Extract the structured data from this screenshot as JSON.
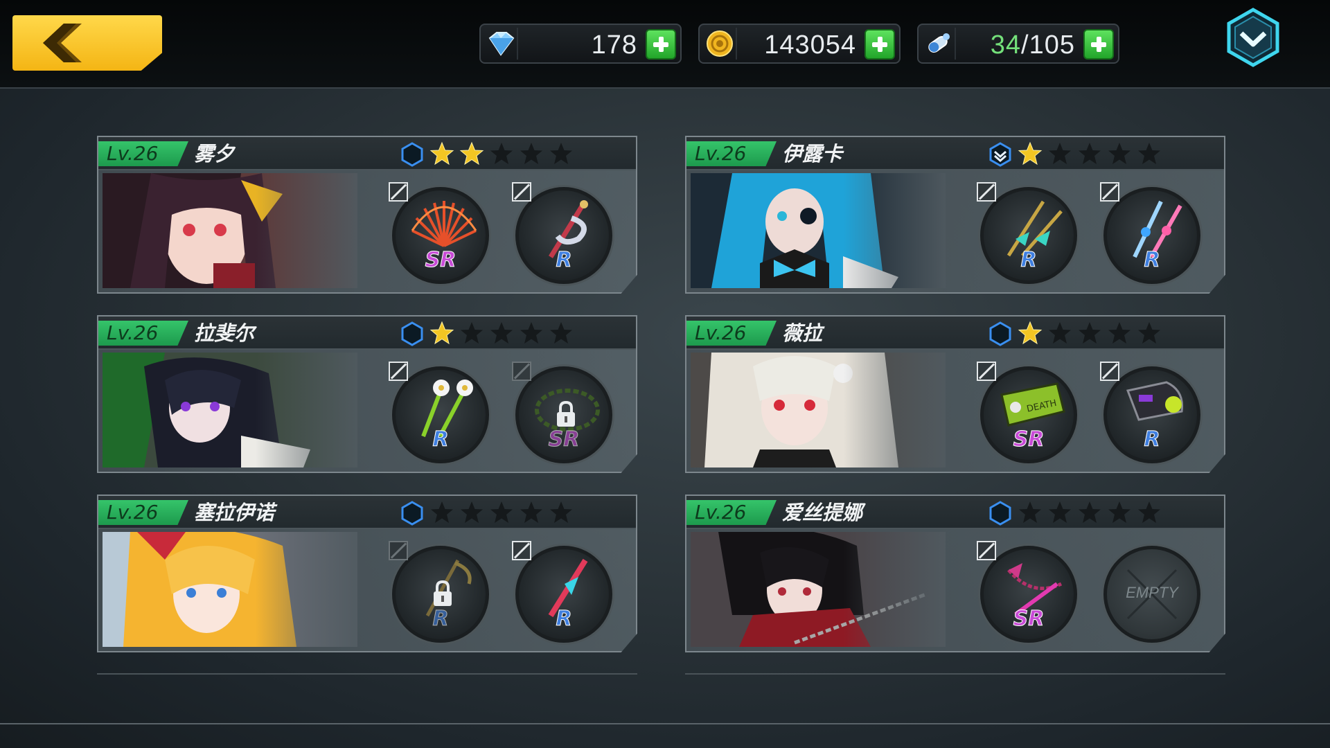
{
  "resources": {
    "gems": {
      "value": "178",
      "icon": "diamond-icon"
    },
    "gold": {
      "value": "143054",
      "icon": "coin-icon"
    },
    "energy": {
      "current": "34",
      "max": "/105",
      "icon": "potion-icon"
    }
  },
  "colors": {
    "level_badge": "#2bb35c",
    "back_button": "#f4b514",
    "plus_button": "#2fbf37",
    "star_filled": "#f3c623",
    "rarity_sr": "#c84bd6",
    "rarity_r": "#3f7fe0"
  },
  "characters": [
    {
      "level": "Lv.26",
      "name": "雾夕",
      "stars_filled": 2,
      "stars_total": 5,
      "slot1": {
        "rarity": "SR",
        "locked": false
      },
      "slot2": {
        "rarity": "R",
        "locked": false
      }
    },
    {
      "level": "Lv.26",
      "name": "伊露卡",
      "stars_filled": 1,
      "stars_total": 5,
      "slot1": {
        "rarity": "R",
        "locked": false
      },
      "slot2": {
        "rarity": "R",
        "locked": false
      }
    },
    {
      "level": "Lv.26",
      "name": "拉斐尔",
      "stars_filled": 1,
      "stars_total": 5,
      "slot1": {
        "rarity": "R",
        "locked": false
      },
      "slot2": {
        "rarity": "SR",
        "locked": true
      }
    },
    {
      "level": "Lv.26",
      "name": "薇拉",
      "stars_filled": 1,
      "stars_total": 5,
      "slot1": {
        "rarity": "SR",
        "locked": false
      },
      "slot2": {
        "rarity": "R",
        "locked": false
      }
    },
    {
      "level": "Lv.26",
      "name": "塞拉伊诺",
      "stars_filled": 0,
      "stars_total": 5,
      "slot1": {
        "rarity": "R",
        "locked": true
      },
      "slot2": {
        "rarity": "R",
        "locked": false
      }
    },
    {
      "level": "Lv.26",
      "name": "爱丝提娜",
      "stars_filled": 0,
      "stars_total": 5,
      "slot1": {
        "rarity": "SR",
        "locked": false
      },
      "slot2": {
        "empty_label": "EMPTY"
      }
    }
  ]
}
